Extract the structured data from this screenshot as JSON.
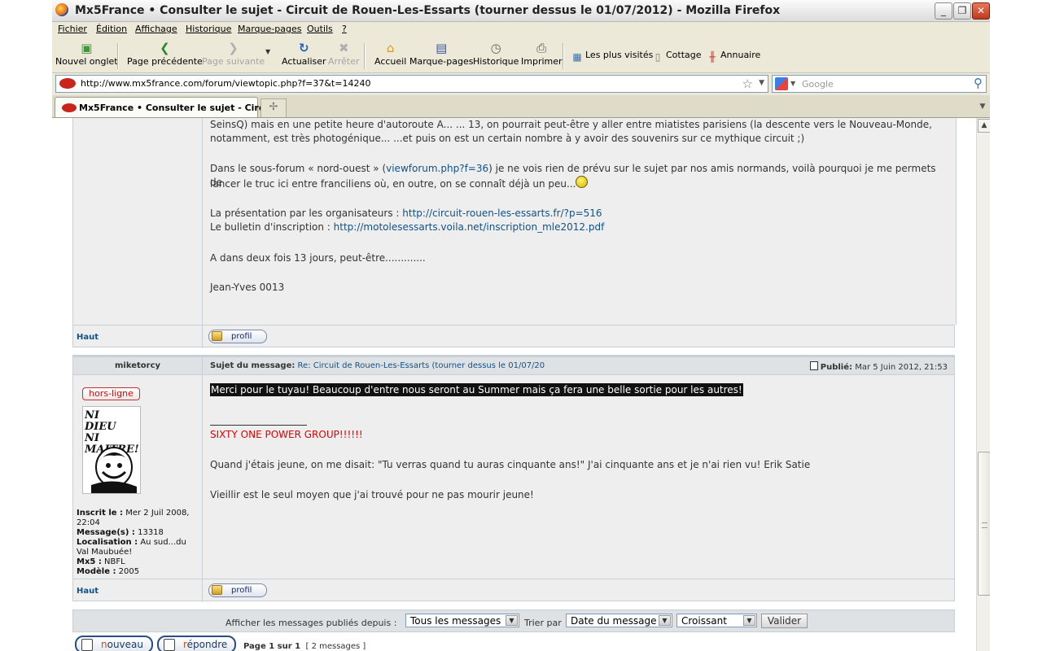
{
  "window": {
    "title": "Mx5France • Consulter le sujet - Circuit de Rouen-Les-Essarts (tourner dessus le 01/07/2012) - Mozilla Firefox",
    "min": "_",
    "restore": "❐",
    "close": "✕"
  },
  "menu": [
    "Fichier",
    "Édition",
    "Affichage",
    "Historique",
    "Marque-pages",
    "Outils",
    "?"
  ],
  "toolbar": {
    "new_tab": "Nouvel onglet",
    "back": "Page précédente",
    "forward": "Page suivante",
    "reload": "Actualiser",
    "stop": "Arrêter",
    "home": "Accueil",
    "bookmarks": "Marque-pages",
    "history": "Historique",
    "print": "Imprimer"
  },
  "bookmarks_bar": [
    "Les plus visités",
    "Cottage",
    "Annuaire"
  ],
  "address": {
    "url": "http://www.mx5france.com/forum/viewtopic.php?f=37&t=14240"
  },
  "search": {
    "placeholder": "Google"
  },
  "tabs": [
    {
      "label": "Mx5France • Consulter le sujet - Circ..."
    }
  ],
  "post1": {
    "line1": "SeinsQ) mais en une petite heure d'autoroute A... ... 13, on pourrait peut-être y aller entre miatistes parisiens (la descente vers le Nouveau-Monde,",
    "line2": "notamment, est très photogénique... ...et puis on est un certain nombre à y avoir des souvenirs sur ce mythique circuit ;)",
    "line3a": "Dans le sous-forum « nord-ouest » (",
    "line3link": "viewforum.php?f=36",
    "line3b": ") je ne vois rien de prévu sur le sujet par nos amis normands, voilà pourquoi je me permets de",
    "line4": "lancer le truc ici entre franciliens où, en outre, on se connaît déjà un peu...",
    "pres_label": "La présentation par les organisateurs : ",
    "pres_link": "http://circuit-rouen-les-essarts.fr/?p=516",
    "bull_label": "Le bulletin d'inscription : ",
    "bull_link": "http://motolesessarts.voila.net/inscription_mle2012.pdf",
    "line_a": "A dans deux fois 13 jours, peut-être.............",
    "sign": "Jean-Yves 0013"
  },
  "post_footer": {
    "top": "Haut",
    "profile": "profil"
  },
  "post2": {
    "author": "miketorcy",
    "subject_label": "Sujet du message:",
    "subject": "Re: Circuit de Rouen-Les-Essarts (tourner dessus le 01/07/20",
    "published_label": "Publié:",
    "published": "Mar 5 Juin 2012, 21:53",
    "status": "hors-ligne",
    "avatar_text": "NI DIEU NI MAITRE!",
    "info": {
      "joined_label": "Inscrit le :",
      "joined": "Mer 2 Juil 2008, 22:04",
      "messages_label": "Message(s) :",
      "messages": "13318",
      "location_label": "Localisation :",
      "location": "Au sud...du Val Maubuée!",
      "mx5_label": "Mx5 :",
      "mx5": "NBFL",
      "model_label": "Modèle :",
      "model": "2005"
    },
    "body": "Merci pour le tuyau! Beaucoup d'entre nous seront au Summer mais ça fera une belle sortie pour les autres!",
    "sig1": "SIXTY ONE POWER GROUP!!!!!!",
    "sig2": "Quand j'étais jeune, on me disait: \"Tu verras quand tu auras cinquante ans!\" J'ai cinquante ans et je n'ai rien vu! Erik Satie",
    "sig3": "Vieillir est le seul moyen que j'ai trouvé pour ne pas mourir jeune!"
  },
  "sortbar": {
    "show_label": "Afficher les messages publiés depuis :",
    "show_value": "Tous les messages",
    "sort_label": "Trier par",
    "sort_value": "Date du message",
    "order_value": "Croissant",
    "submit": "Valider"
  },
  "bottom": {
    "new_first": "n",
    "new_rest": "ouveau",
    "reply_first": "r",
    "reply_rest": "épondre",
    "page": "Page 1 sur 1",
    "count": "[ 2 messages ]"
  }
}
